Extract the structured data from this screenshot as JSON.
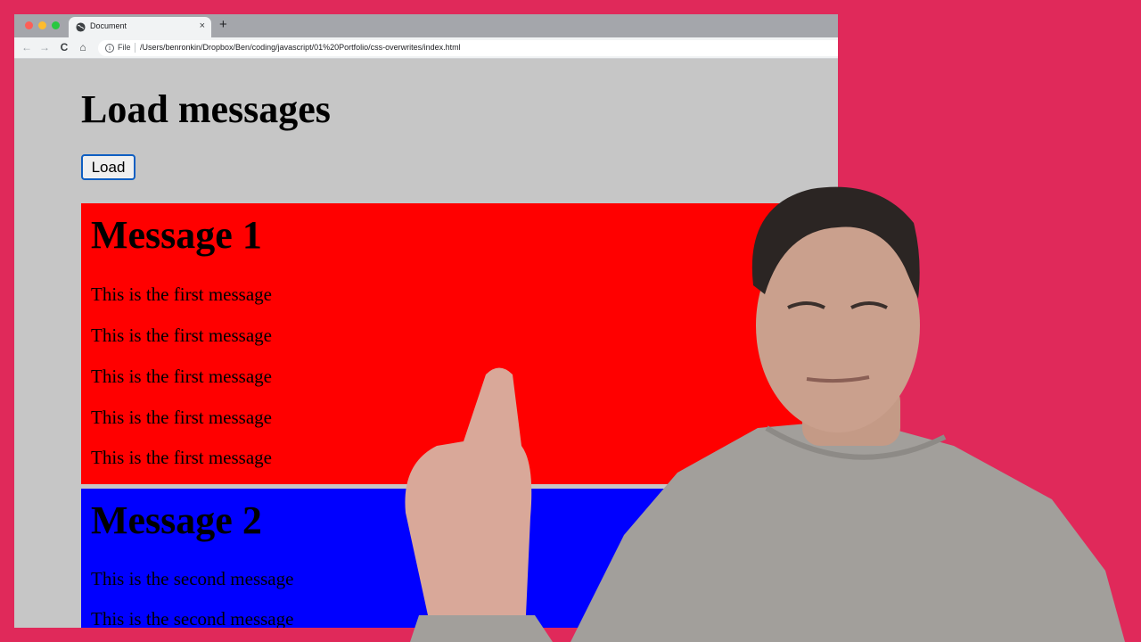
{
  "browser": {
    "tab": {
      "title": "Document",
      "close_glyph": "×",
      "favicon": "globe-icon"
    },
    "new_tab_glyph": "+",
    "nav": {
      "back_glyph": "←",
      "forward_glyph": "→",
      "reload_glyph": "C",
      "home_glyph": "⌂"
    },
    "address": {
      "info_glyph": "i",
      "scheme": "File",
      "url": "/Users/benronkin/Dropbox/Ben/coding/javascript/01%20Portfolio/css-overwrites/index.html"
    }
  },
  "page": {
    "heading": "Load messages",
    "load_button": "Load",
    "messages": [
      {
        "title": "Message 1",
        "color": "#ff0000",
        "lines": [
          "This is the first message",
          "This is the first message",
          "This is the first message",
          "This is the first message",
          "This is the first message"
        ]
      },
      {
        "title": "Message 2",
        "color": "#0000ff",
        "lines": [
          "This is the second message",
          "This is the second message"
        ]
      }
    ]
  },
  "colors": {
    "background": "#e0295a",
    "page_background": "#c6c6c6"
  }
}
